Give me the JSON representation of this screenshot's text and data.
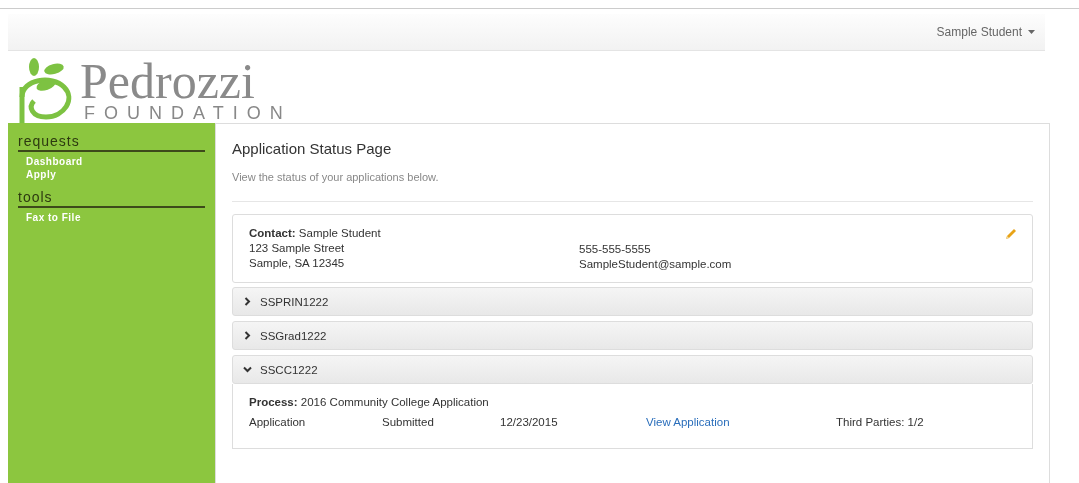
{
  "navbar": {
    "user_menu": "Sample Student"
  },
  "logo": {
    "name": "Pedrozzi",
    "subtitle": "FOUNDATION"
  },
  "sidebar": {
    "sections": [
      {
        "title": "requests",
        "items": [
          {
            "label": "Dashboard"
          },
          {
            "label": "Apply"
          }
        ]
      },
      {
        "title": "tools",
        "items": [
          {
            "label": "Fax to File"
          }
        ]
      }
    ]
  },
  "main": {
    "title": "Application Status Page",
    "subtitle": "View the status of your applications below.",
    "contact": {
      "label": "Contact:",
      "name": "Sample Student",
      "address": [
        "123 Sample Street",
        "Sample, SA 12345"
      ],
      "phone": "555-555-5555",
      "email": "SampleStudent@sample.com"
    },
    "applications": [
      {
        "code": "SSPRIN1222",
        "expanded": false
      },
      {
        "code": "SSGrad1222",
        "expanded": false
      },
      {
        "code": "SSCC1222",
        "expanded": true,
        "process_label": "Process:",
        "process": "2016 Community College Application",
        "type": "Application",
        "status": "Submitted",
        "date": "12/23/2015",
        "link": "View Application",
        "third_parties": "Third Parties: 1/2"
      }
    ]
  }
}
